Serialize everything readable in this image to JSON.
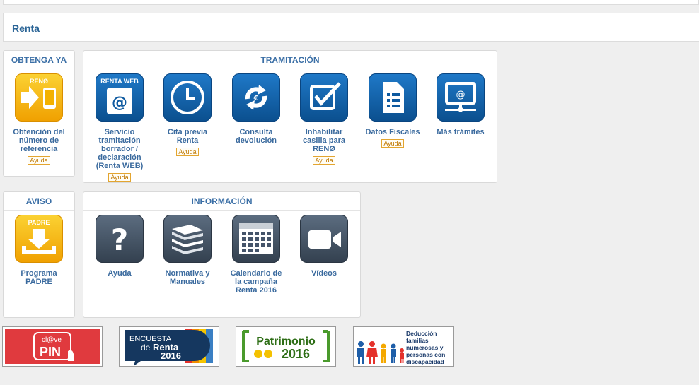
{
  "title": "Renta",
  "obtenga": {
    "heading": "OBTENGA YA",
    "tile": {
      "icon_text": "RENØ",
      "label": "Obtención del número de referencia",
      "help": "Ayuda"
    }
  },
  "tramitacion": {
    "heading": "TRAMITACIÓN",
    "tiles": [
      {
        "icon_text": "RENTA WEB",
        "label": "Servicio tramitación borrador / declaración (Renta WEB)",
        "help": "Ayuda"
      },
      {
        "label": "Cita previa Renta",
        "help": "Ayuda"
      },
      {
        "label": "Consulta devolución",
        "help": ""
      },
      {
        "label": "Inhabilitar casilla para RENØ",
        "help": "Ayuda"
      },
      {
        "label": "Datos Fiscales",
        "help": "Ayuda"
      },
      {
        "label": "Más trámites",
        "help": ""
      }
    ]
  },
  "aviso": {
    "heading": "AVISO",
    "tile": {
      "icon_text": "PADRE",
      "label": "Programa PADRE"
    }
  },
  "informacion": {
    "heading": "INFORMACIÓN",
    "tiles": [
      {
        "label": "Ayuda"
      },
      {
        "label": "Normativa y Manuales"
      },
      {
        "label": "Calendario de la campaña Renta 2016"
      },
      {
        "label": "Vídeos"
      }
    ]
  },
  "banners": {
    "clave": {
      "line1": "cl@ve",
      "line2": "PIN"
    },
    "encuesta": {
      "line1": "ENCUESTA",
      "line2": "de",
      "line3": "Renta",
      "line4": "2016"
    },
    "patrimonio": {
      "line1": "Patrimonio",
      "line2": "2016"
    },
    "deduccion": {
      "line1": "Deducción",
      "line2": "familias",
      "line3": "numerosas y",
      "line4": "personas con",
      "line5": "discapacidad"
    }
  }
}
